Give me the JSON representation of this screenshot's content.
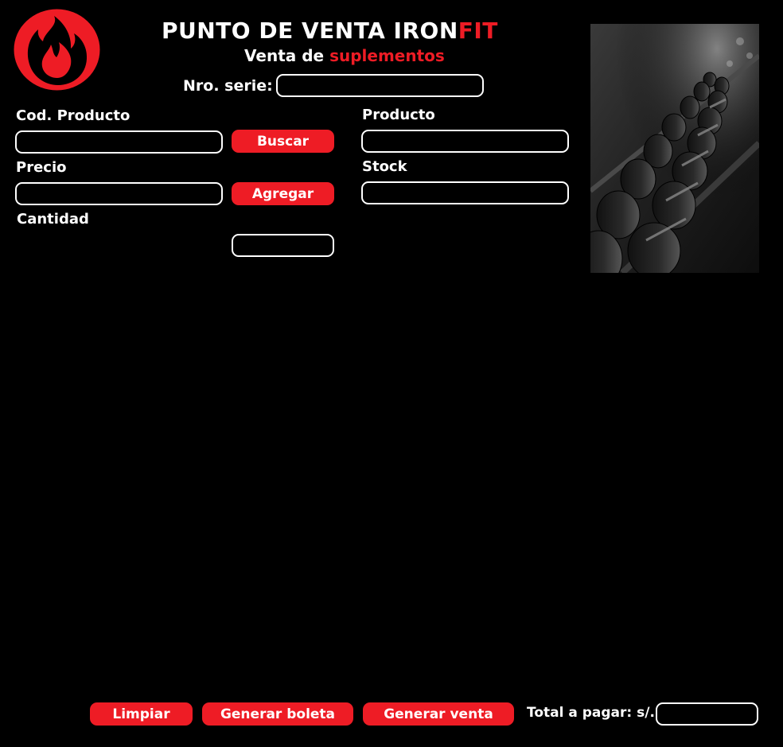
{
  "header": {
    "title_main": "PUNTO DE VENTA IRON",
    "title_accent": "FIT",
    "subtitle_main": "Venta de ",
    "subtitle_accent": "suplementos",
    "serie_label": "Nro. serie:"
  },
  "form": {
    "cod_producto_label": "Cod. Producto",
    "producto_label": "Producto",
    "precio_label": "Precio",
    "stock_label": "Stock",
    "cantidad_label": "Cantidad",
    "buscar_label": "Buscar",
    "agregar_label": "Agregar"
  },
  "footer": {
    "limpiar_label": "Limpiar",
    "generar_boleta_label": "Generar boleta",
    "generar_venta_label": "Generar venta",
    "total_label": "Total a pagar: s/."
  },
  "colors": {
    "accent": "#ee1c25",
    "background": "#000000",
    "text": "#ffffff"
  },
  "icons": {
    "logo": "flame-icon",
    "photo": "dumbbell-rack-image"
  }
}
